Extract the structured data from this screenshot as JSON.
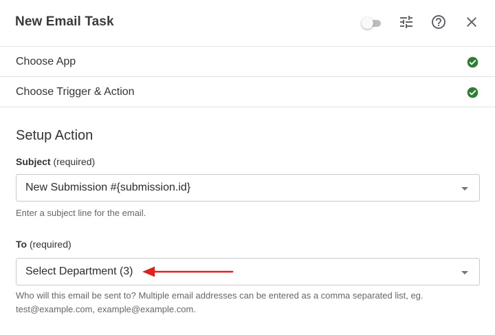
{
  "header": {
    "title": "New Email Task",
    "icons": [
      "toggle-switch",
      "tune-icon",
      "help-icon",
      "close-icon"
    ]
  },
  "steps": [
    {
      "label": "Choose App",
      "status": "complete"
    },
    {
      "label": "Choose Trigger & Action",
      "status": "complete"
    }
  ],
  "setup": {
    "title": "Setup Action",
    "subject": {
      "label": "Subject",
      "required": "(required)",
      "value": "New Submission #{submission.id}",
      "helper": "Enter a subject line for the email."
    },
    "to": {
      "label": "To",
      "required": "(required)",
      "value": "Select Department (3)",
      "helper": "Who will this email be sent to? Multiple email addresses can be entered as a comma separated list, eg. test@example.com, example@example.com."
    }
  },
  "colors": {
    "success": "#2e7d32",
    "annotation_arrow": "#e02020",
    "divider": "#e3e3e3"
  }
}
